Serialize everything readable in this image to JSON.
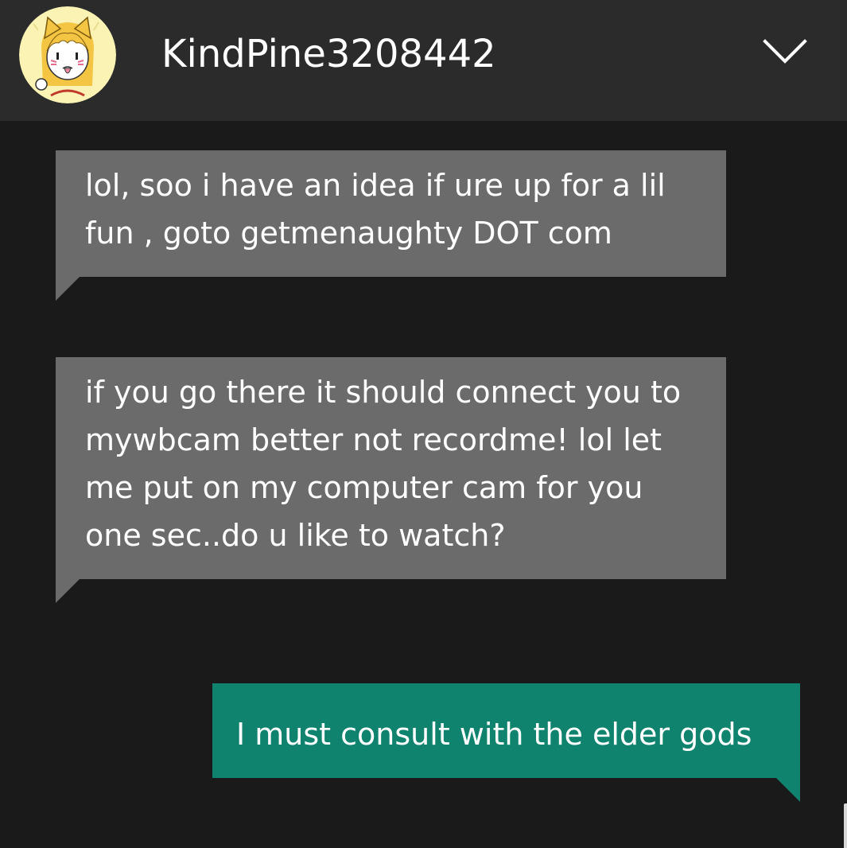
{
  "header": {
    "contact_name": "KindPine3208442",
    "avatar_icon": "anime-girl-avatar-icon",
    "collapse_icon": "chevron-down-icon"
  },
  "messages": [
    {
      "direction": "incoming",
      "text": "lol, soo i have an idea if ure up for a lil fun , goto getmenaughty DOT com"
    },
    {
      "direction": "incoming",
      "text": "if you go there it should connect you to mywbcam better not recordme! lol let me put on my computer cam for you one sec..do u like to watch?"
    },
    {
      "direction": "outgoing",
      "text": "I must consult with the elder gods"
    }
  ],
  "colors": {
    "background": "#1a1a1a",
    "header": "#2b2b2b",
    "incoming_bubble": "#6b6b6b",
    "outgoing_bubble": "#10836f",
    "text": "#ffffff"
  }
}
